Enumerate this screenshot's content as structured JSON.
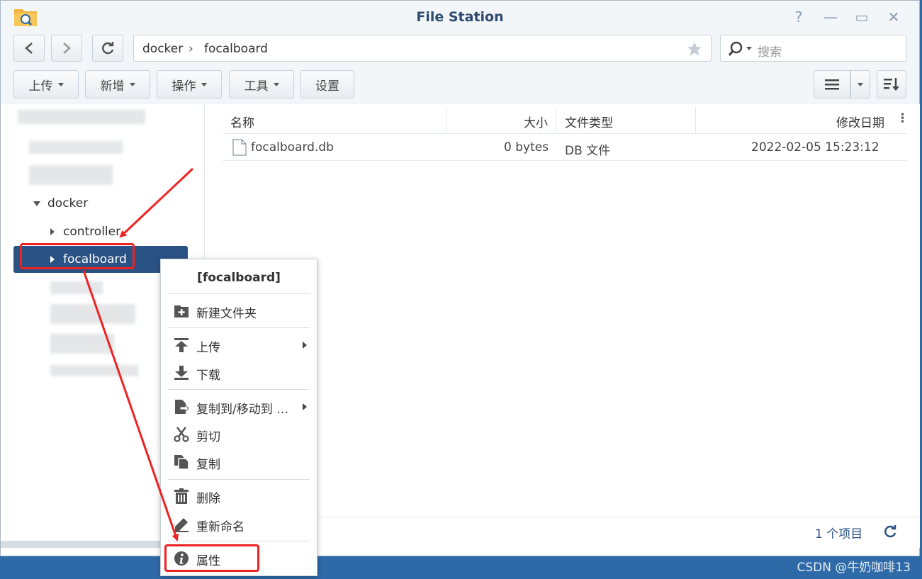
{
  "window": {
    "title": "File Station"
  },
  "titlebar": {
    "help_glyph": "?",
    "minimize_glyph": "—",
    "maximize_glyph": "▭",
    "close_glyph": "✕"
  },
  "address": {
    "crumbs": [
      "docker",
      "focalboard"
    ],
    "separator": "›"
  },
  "search": {
    "placeholder": "搜索"
  },
  "toolbar": {
    "upload": "上传",
    "create": "新增",
    "action": "操作",
    "tools": "工具",
    "settings": "设置"
  },
  "sidebar": {
    "docker": "docker",
    "controller": "controller",
    "focalboard": "focalboard"
  },
  "table": {
    "headers": {
      "name": "名称",
      "size": "大小",
      "type": "文件类型",
      "modified": "修改日期"
    },
    "rows": [
      {
        "name": "focalboard.db",
        "size": "0 bytes",
        "type": "DB 文件",
        "modified": "2022-02-05 15:23:12"
      }
    ]
  },
  "status": {
    "count": "1 个项目"
  },
  "context_menu": {
    "title": "[focalboard]",
    "items": {
      "new_folder": "新建文件夹",
      "upload": "上传",
      "download": "下载",
      "copy_move_to": "复制到/移动到 …",
      "cut": "剪切",
      "copy": "复制",
      "delete": "删除",
      "rename": "重新命名",
      "properties": "属性"
    }
  },
  "watermark": "CSDN @牛奶咖啡13",
  "colors": {
    "selected": "#2b5285",
    "annotation": "#ee2222",
    "background": "#2e6aa8"
  }
}
